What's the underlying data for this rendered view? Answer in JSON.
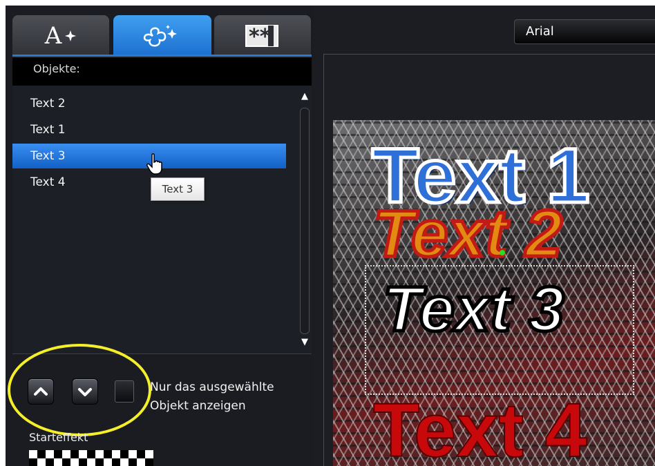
{
  "tabs": [
    {
      "name": "text-properties",
      "label": "A",
      "icon": "sparkle-text-icon"
    },
    {
      "name": "effects",
      "label": "",
      "icon": "flower-sparkle-icon",
      "active": true
    },
    {
      "name": "overlay",
      "label": "",
      "icon": "asterisk-frame-icon"
    }
  ],
  "objects": {
    "header": "Objekte:",
    "items": [
      {
        "label": "Text 2"
      },
      {
        "label": "Text 1"
      },
      {
        "label": "Text 3",
        "selected": true
      },
      {
        "label": "Text 4"
      }
    ],
    "tooltip": "Text 3"
  },
  "controls": {
    "move_up_icon": "chevron-up-icon",
    "move_down_icon": "chevron-down-icon",
    "show_only_selected_label": "Nur das ausgewählte Objekt anzeigen",
    "show_only_selected_checked": false
  },
  "start_effect": {
    "label": "Starteffekt"
  },
  "font": {
    "selected": "Arial"
  },
  "preview": {
    "texts": [
      "Text 1",
      "Text 2",
      "Text 3",
      "Text 4"
    ]
  },
  "colors": {
    "accent": "#1c6fd0",
    "highlight": "#f5ef29",
    "panel_bg": "#1a1c21"
  }
}
